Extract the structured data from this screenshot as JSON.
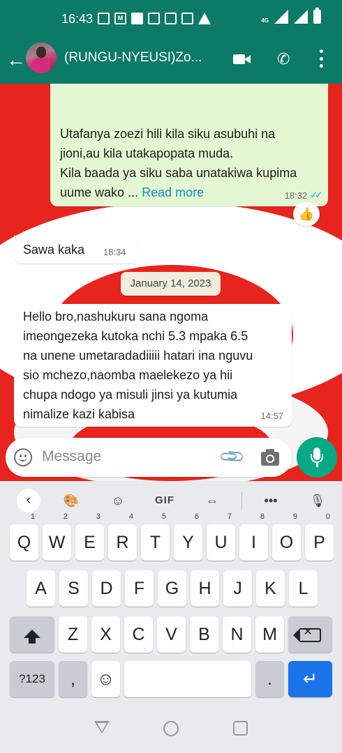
{
  "status_bar": {
    "time": "16:43",
    "notification_icons": [
      "gallery-icon",
      "gmail-icon",
      "image-icon",
      "id-card-icon",
      "id-card-icon",
      "phone-alert-icon",
      "warning-icon"
    ],
    "network": "4G"
  },
  "app_bar": {
    "chat_title": "(RUNGU-NYEUSI)Zo...",
    "back_icon": "arrow-left-icon",
    "actions": [
      "video-call-icon",
      "voice-call-icon",
      "more-options-icon"
    ],
    "color": "#0b7a67"
  },
  "messages": [
    {
      "direction": "outgoing",
      "lines": [
        "Utafanya zoezi hili kila siku asubuhi na",
        "jioni,au kila utakapopata muda.",
        "Kila baada ya siku saba unatakiwa kupima",
        "uume wako ..."
      ],
      "read_more": "Read more",
      "time": "18:32",
      "status": "read",
      "reaction": "👍"
    },
    {
      "direction": "incoming",
      "text": "Sawa kaka",
      "time": "18:34"
    },
    {
      "direction": "incoming",
      "lines": [
        "Hello bro,nashukuru sana ngoma",
        "imeongezeka kutoka nchi 5.3 mpaka 6.5",
        "na unene umetaradadiiiii hatari ina nguvu",
        "sio mchezo,naomba maelekezo ya hii",
        "chupa ndogo ya misuli jinsi ya kutumia",
        "nimalize kazi kabisa"
      ],
      "time": "14:57"
    }
  ],
  "date_separator": "January 14, 2023",
  "composer": {
    "placeholder": "Message",
    "icons": [
      "emoji-icon",
      "attach-icon",
      "camera-icon",
      "mic-icon"
    ],
    "send_color": "#07a884"
  },
  "keyboard": {
    "toolbar": [
      "‹",
      "palette-icon",
      "sticker-icon",
      "GIF",
      "cursor-icon",
      "•••",
      "mic-icon"
    ],
    "row1": [
      {
        "k": "Q",
        "n": "1"
      },
      {
        "k": "W",
        "n": "2"
      },
      {
        "k": "E",
        "n": "3"
      },
      {
        "k": "R",
        "n": "4"
      },
      {
        "k": "T",
        "n": "5"
      },
      {
        "k": "Y",
        "n": "6"
      },
      {
        "k": "U",
        "n": "7"
      },
      {
        "k": "I",
        "n": "8"
      },
      {
        "k": "O",
        "n": "9"
      },
      {
        "k": "P",
        "n": "0"
      }
    ],
    "row2": [
      "A",
      "S",
      "D",
      "F",
      "G",
      "H",
      "J",
      "K",
      "L"
    ],
    "row3": [
      "Z",
      "X",
      "C",
      "V",
      "B",
      "N",
      "M"
    ],
    "row4": {
      "symbols": "?123",
      "comma": ",",
      "period": "."
    },
    "enter_color": "#1a73e8"
  },
  "nav_bar": [
    "nav-back-icon",
    "nav-home-icon",
    "nav-recents-icon"
  ]
}
